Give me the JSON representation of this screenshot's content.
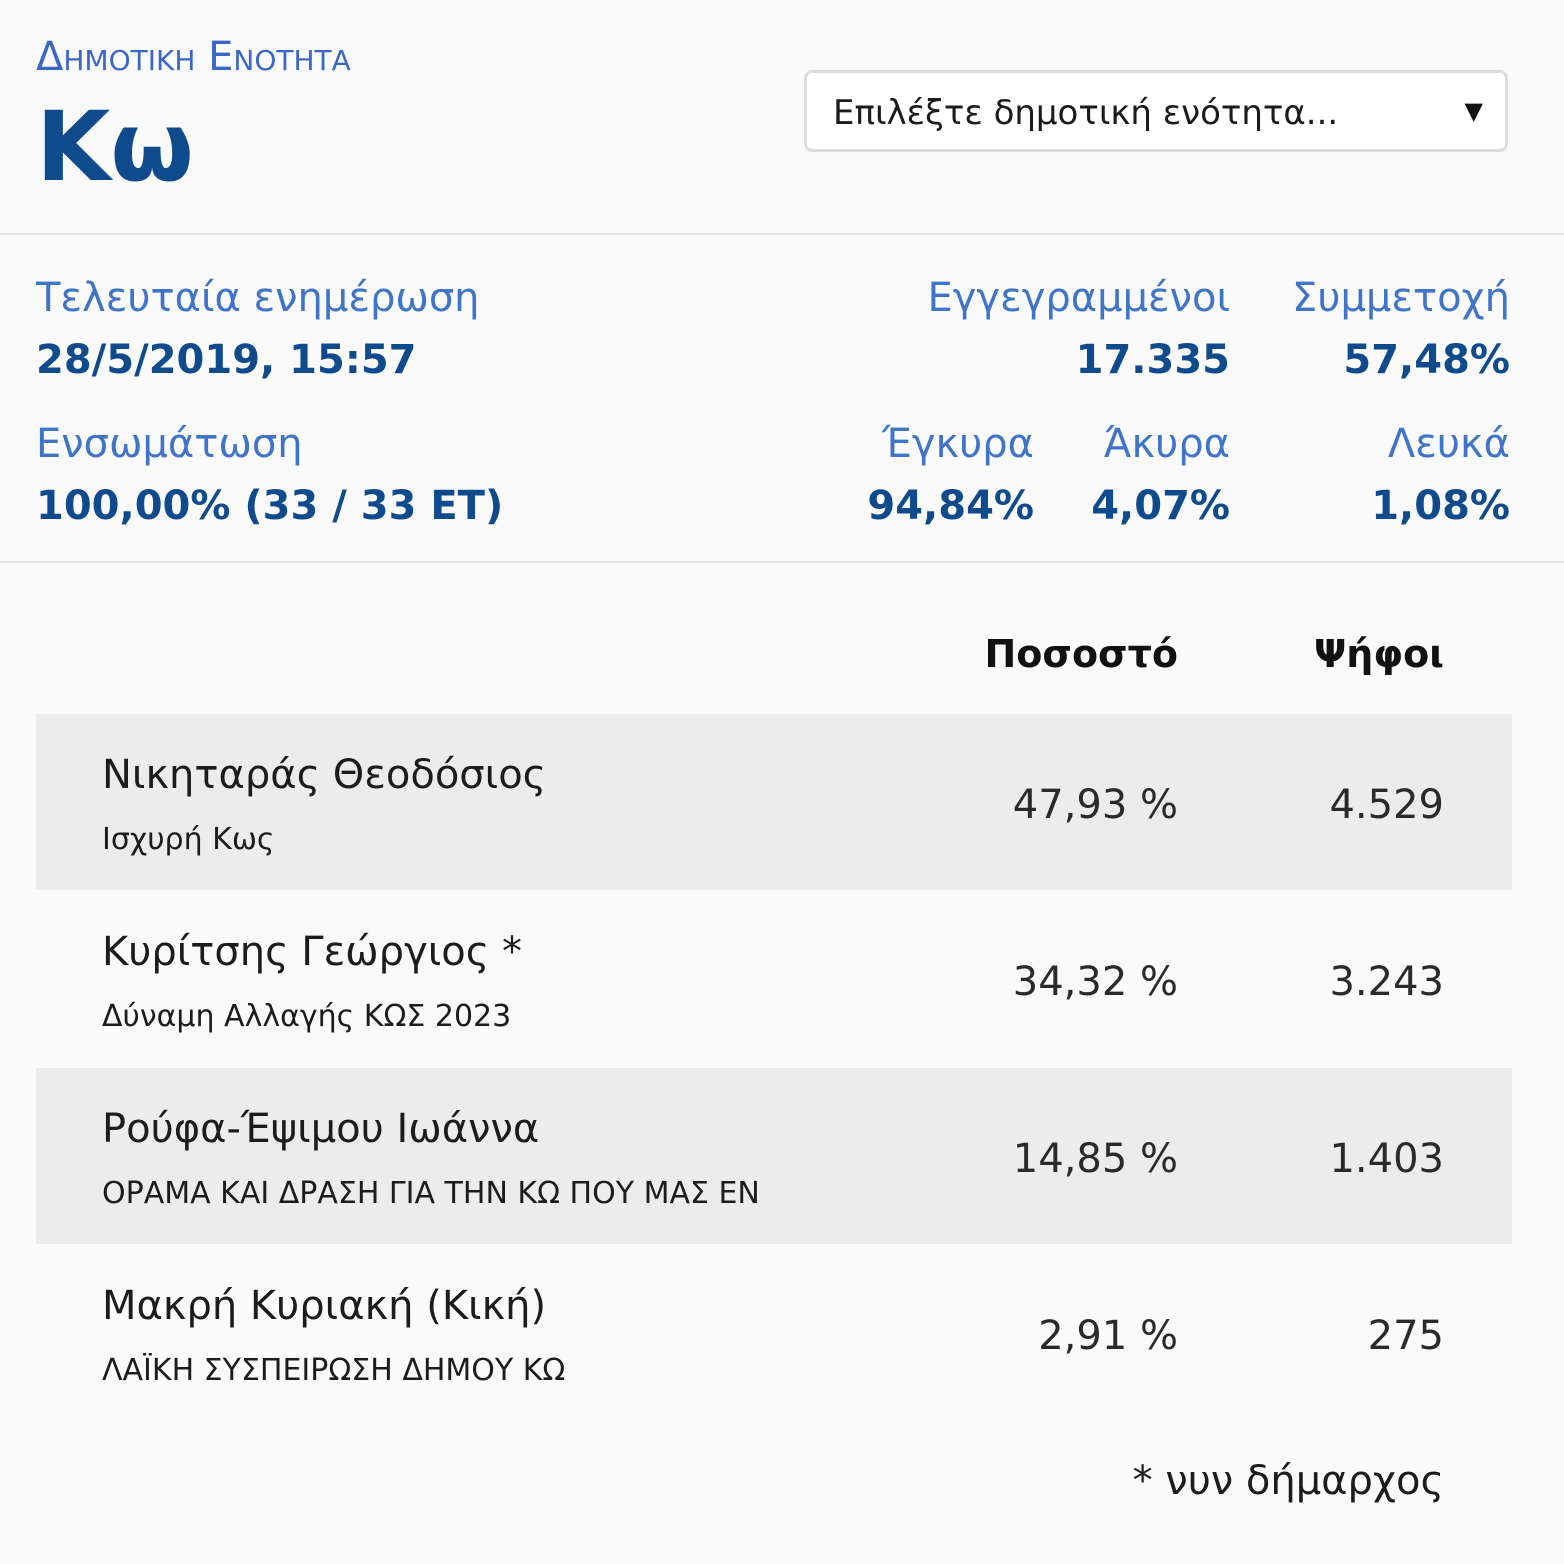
{
  "header": {
    "kicker": "Δημοτικη Ενοτητα",
    "title": "Κω",
    "select": {
      "placeholder": "Επιλέξτε δημοτική ενότητα...",
      "arrow": "▼"
    }
  },
  "stats": {
    "last_update_label": "Τελευταία ενημέρωση",
    "last_update_value": "28/5/2019, 15:57",
    "registered_label": "Εγγεγραμμένοι",
    "registered_value": "17.335",
    "turnout_label": "Συμμετοχή",
    "turnout_value": "57,48%",
    "integration_label": "Ενσωμάτωση",
    "integration_value": "100,00% (33 / 33 ΕΤ)",
    "valid_label": "Έγκυρα",
    "valid_value": "94,84%",
    "invalid_label": "Άκυρα",
    "invalid_value": "4,07%",
    "blank_label": "Λευκά",
    "blank_value": "1,08%"
  },
  "results": {
    "columns": {
      "percent": "Ποσοστό",
      "votes": "Ψήφοι"
    },
    "rows": [
      {
        "name": "Νικηταράς Θεοδόσιος",
        "party": "Ισχυρή Κως",
        "percent": "47,93 %",
        "votes": "4.529"
      },
      {
        "name": "Κυρίτσης Γεώργιος *",
        "party": "Δύναμη Αλλαγής ΚΩΣ 2023",
        "percent": "34,32 %",
        "votes": "3.243"
      },
      {
        "name": "Ρούφα-Έψιμου Ιωάννα",
        "party": "ΟΡΑΜΑ ΚΑΙ ΔΡΑΣΗ ΓΙΑ ΤΗΝ ΚΩ ΠΟΥ ΜΑΣ ΕΝ",
        "percent": "14,85 %",
        "votes": "1.403"
      },
      {
        "name": "Μακρή Κυριακή (Κική)",
        "party": "ΛΑΪΚΗ ΣΥΣΠΕΙΡΩΣΗ ΔΗΜΟΥ ΚΩ",
        "percent": "2,91 %",
        "votes": "275"
      }
    ],
    "footnote": "* νυν δήμαρχος"
  }
}
